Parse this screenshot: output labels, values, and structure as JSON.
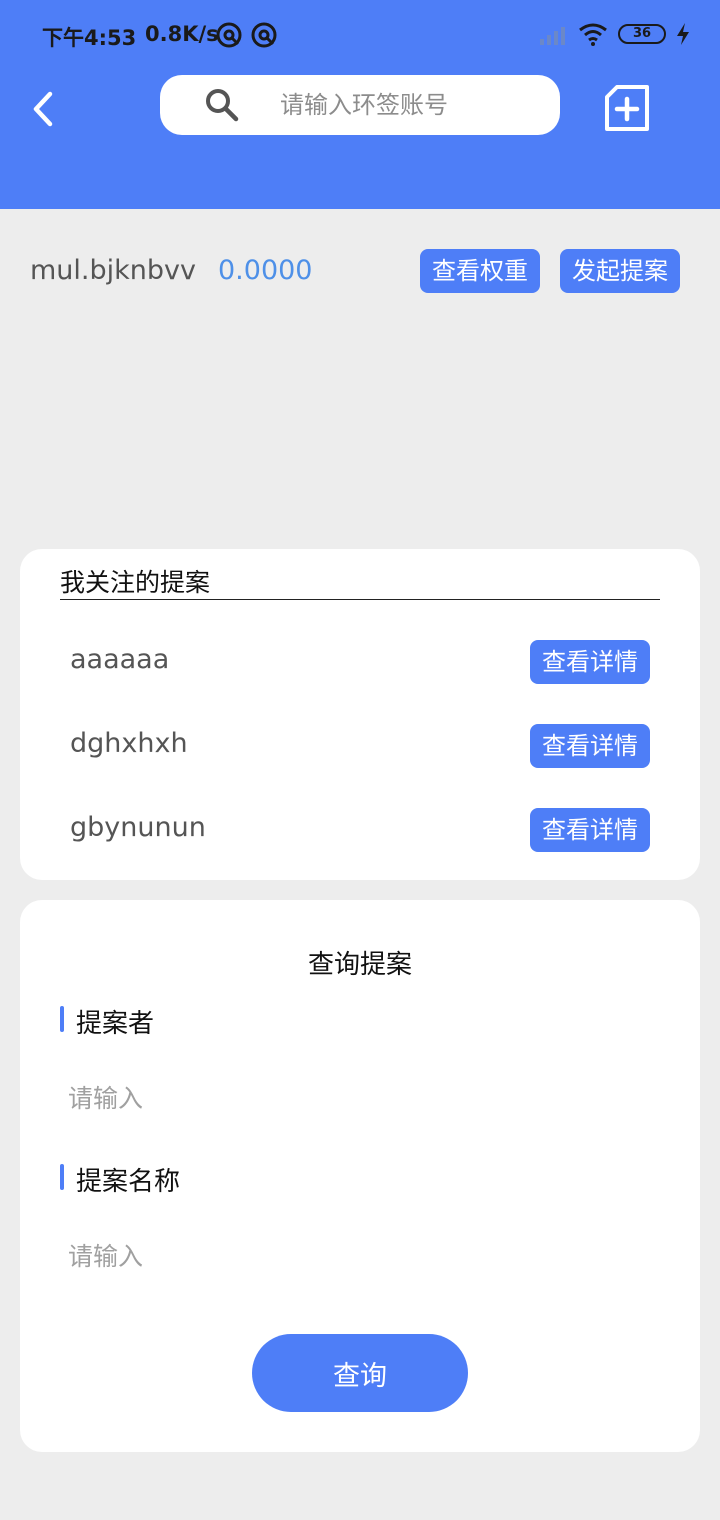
{
  "status_bar": {
    "time": "下午4:53",
    "speed": "0.8K/s",
    "battery": "36"
  },
  "header": {
    "search_placeholder": "请输入环签账号",
    "icons": [
      "chevron-left-icon",
      "search-icon",
      "add-square-icon"
    ]
  },
  "account": {
    "name": "mul.bjknbvv",
    "balance": "0.0000",
    "view_weight_label": "查看权重",
    "create_proposal_label": "发起提案"
  },
  "watch_list": {
    "title": "我关注的提案",
    "detail_label": "查看详情",
    "items": [
      {
        "name": "aaaaaa"
      },
      {
        "name": "dghxhxh"
      },
      {
        "name": "gbynunun"
      }
    ]
  },
  "query": {
    "title": "查询提案",
    "proposer_label": "提案者",
    "proposer_placeholder": "请输入",
    "proposal_name_label": "提案名称",
    "proposal_name_placeholder": "请输入",
    "submit_label": "查询"
  },
  "colors": {
    "accent": "#4e7ef7",
    "balance": "#4e90e8",
    "page_bg": "#ededed"
  }
}
